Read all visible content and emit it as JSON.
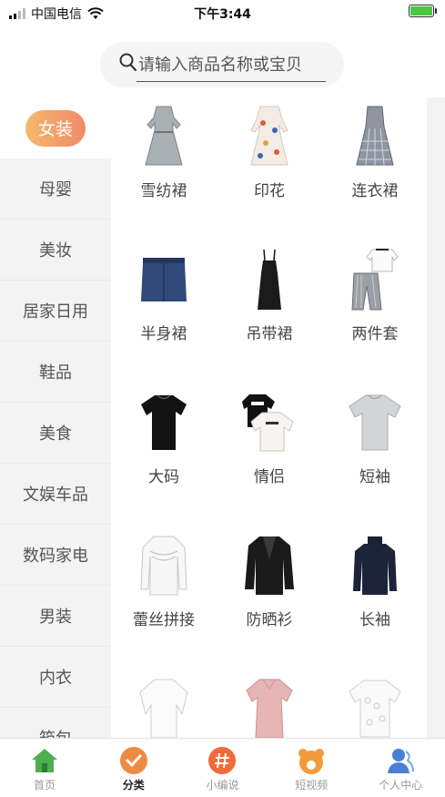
{
  "status_bar": {
    "carrier": "中国电信",
    "time": "下午3:44"
  },
  "search": {
    "placeholder": "请输入商品名称或宝贝"
  },
  "sidebar": {
    "items": [
      {
        "label": "女装",
        "active": true
      },
      {
        "label": "母婴"
      },
      {
        "label": "美妆"
      },
      {
        "label": "居家日用"
      },
      {
        "label": "鞋品"
      },
      {
        "label": "美食"
      },
      {
        "label": "文娱车品"
      },
      {
        "label": "数码家电"
      },
      {
        "label": "男装"
      },
      {
        "label": "内衣"
      },
      {
        "label": "箱包"
      }
    ]
  },
  "categories": [
    {
      "label": "雪纺裙",
      "icon": "chiffon-dress-icon"
    },
    {
      "label": "印花",
      "icon": "print-dress-icon"
    },
    {
      "label": "连衣裙",
      "icon": "plaid-dress-icon"
    },
    {
      "label": "半身裙",
      "icon": "denim-skirt-icon"
    },
    {
      "label": "吊带裙",
      "icon": "slip-dress-icon"
    },
    {
      "label": "两件套",
      "icon": "two-piece-set-icon"
    },
    {
      "label": "大码",
      "icon": "black-tee-icon"
    },
    {
      "label": "情侣",
      "icon": "couple-tees-icon"
    },
    {
      "label": "短袖",
      "icon": "gray-tee-icon"
    },
    {
      "label": "蕾丝拼接",
      "icon": "lace-blouse-icon"
    },
    {
      "label": "防晒衫",
      "icon": "black-cardigan-icon"
    },
    {
      "label": "长袖",
      "icon": "navy-sweater-icon"
    },
    {
      "label": "",
      "icon": "white-blouse-icon"
    },
    {
      "label": "",
      "icon": "pink-tee-icon"
    },
    {
      "label": "",
      "icon": "lace-top-icon"
    }
  ],
  "tabbar": {
    "items": [
      {
        "label": "首页",
        "icon": "home-icon"
      },
      {
        "label": "分类",
        "icon": "category-icon",
        "active": true
      },
      {
        "label": "小编说",
        "icon": "hashtag-icon"
      },
      {
        "label": "短视频",
        "icon": "bear-icon"
      },
      {
        "label": "个人中心",
        "icon": "user-icon"
      }
    ]
  },
  "colors": {
    "accent_start": "#f6b86e",
    "accent_end": "#ef8a68",
    "home_green": "#4caf50",
    "user_blue": "#4a7fd6",
    "battery_green": "#49c744"
  }
}
